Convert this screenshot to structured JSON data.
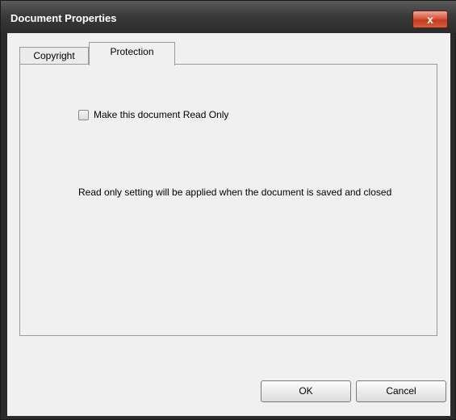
{
  "window": {
    "title": "Document Properties",
    "close_label": "x"
  },
  "tabs": [
    {
      "label": "Copyright",
      "active": false
    },
    {
      "label": "Protection",
      "active": true
    }
  ],
  "protection": {
    "checkbox_label": "Make this document Read Only",
    "checked": false,
    "info_text": "Read only setting will be applied when the document is saved and closed"
  },
  "buttons": {
    "ok_label": "OK",
    "cancel_label": "Cancel"
  }
}
